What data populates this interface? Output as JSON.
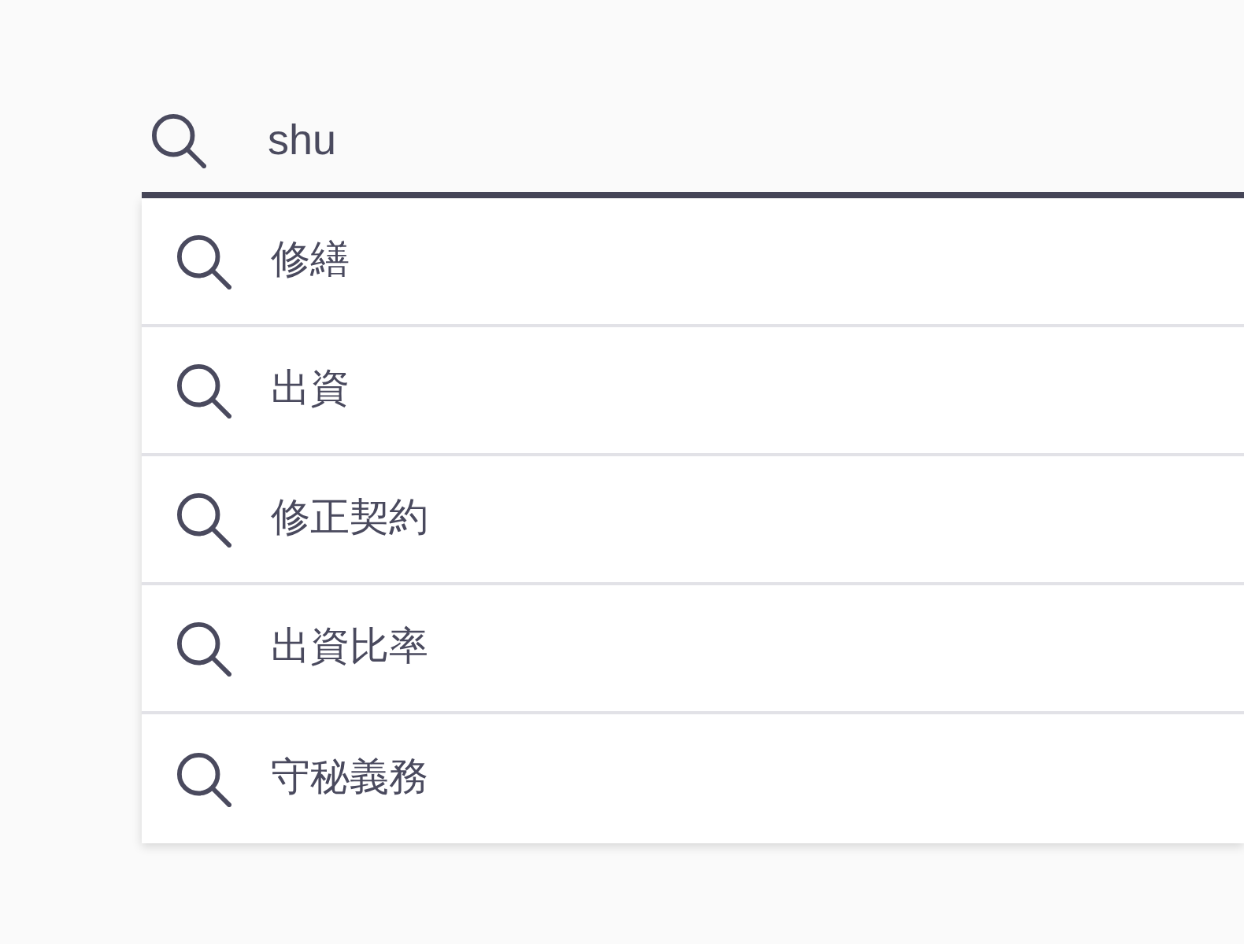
{
  "search": {
    "value": "shu"
  },
  "suggestions": [
    {
      "label": "修繕"
    },
    {
      "label": "出資"
    },
    {
      "label": "修正契約"
    },
    {
      "label": "出資比率"
    },
    {
      "label": "守秘義務"
    }
  ]
}
